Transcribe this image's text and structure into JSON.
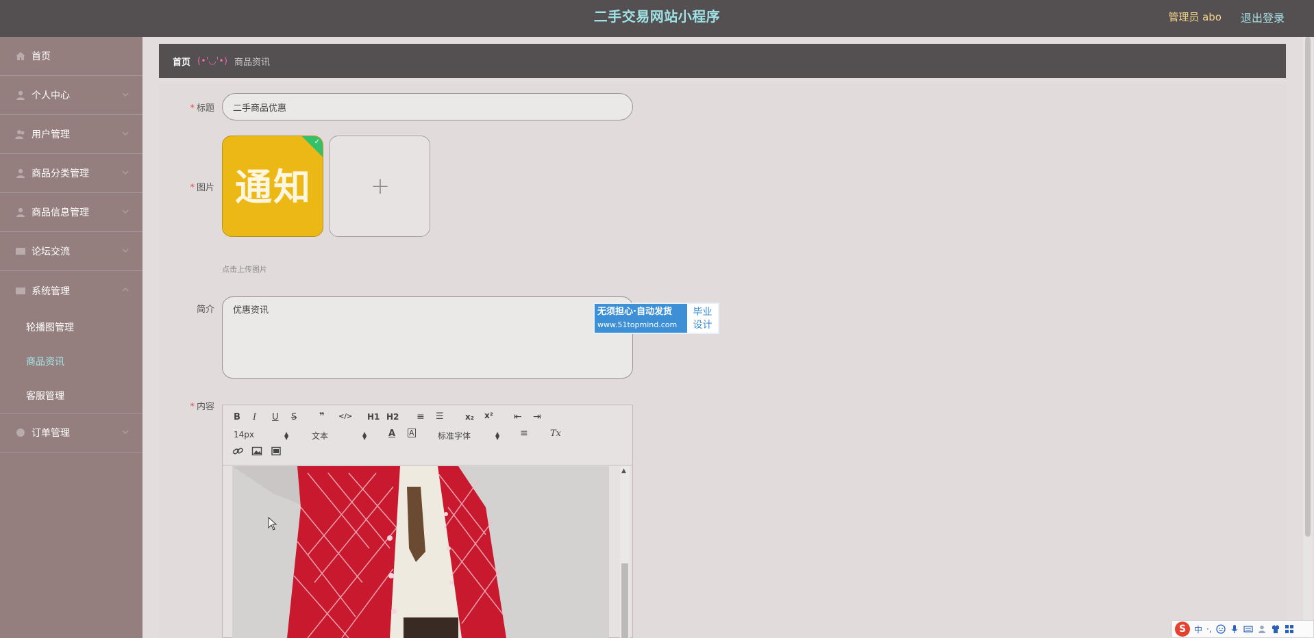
{
  "header": {
    "app_title": "二手交易网站小程序",
    "user_role": "管理员 abo",
    "logout": "退出登录"
  },
  "sidebar": {
    "items": [
      {
        "label": "首页",
        "icon": "home-icon"
      },
      {
        "label": "个人中心",
        "icon": "user-icon"
      },
      {
        "label": "用户管理",
        "icon": "users-icon"
      },
      {
        "label": "商品分类管理",
        "icon": "user-icon"
      },
      {
        "label": "商品信息管理",
        "icon": "user-icon"
      },
      {
        "label": "论坛交流",
        "icon": "forum-icon"
      },
      {
        "label": "系统管理",
        "icon": "system-icon"
      }
    ],
    "system_submenu": [
      {
        "label": "轮播图管理"
      },
      {
        "label": "商品资讯",
        "active": true
      },
      {
        "label": "客服管理"
      }
    ],
    "order_item": {
      "label": "订单管理",
      "icon": "order-icon"
    }
  },
  "breadcrumb": {
    "home": "首页",
    "separator": "(•'◡'•)",
    "current": "商品资讯"
  },
  "form": {
    "title_label": "标题",
    "title_value": "二手商品优惠",
    "image_label": "图片",
    "image_text": "通知",
    "upload_hint": "点击上传图片",
    "intro_label": "简介",
    "intro_value": "优惠资讯",
    "content_label": "内容",
    "required_mark": "*"
  },
  "editor": {
    "toolbar": {
      "bold": "B",
      "italic": "I",
      "underline": "U",
      "strike": "S",
      "quote": "❞",
      "code": "</>",
      "h1": "H1",
      "h2": "H2",
      "ordered_list": "≡",
      "bullet_list": "☰",
      "subscript": "x₂",
      "superscript": "x²",
      "outdent": "⇤",
      "indent": "⇥",
      "font_size": "14px",
      "text_type": "文本",
      "font_family": "标准字体",
      "font_color": "A",
      "bg_color": "A",
      "align": "≡",
      "clean": "Tx"
    }
  },
  "watermark": {
    "line1": "无须担心·自动发货",
    "line2": "www.51topmind.com",
    "right1": "毕业",
    "right2": "设计"
  },
  "ime": {
    "logo": "S",
    "mode": "中",
    "punct": "·,"
  },
  "colors": {
    "topbar": "#544f50",
    "sidebar": "#947f7e",
    "accent_cyan": "#a5e6e8",
    "role_gold": "#f2d48a",
    "required": "#e64545"
  }
}
